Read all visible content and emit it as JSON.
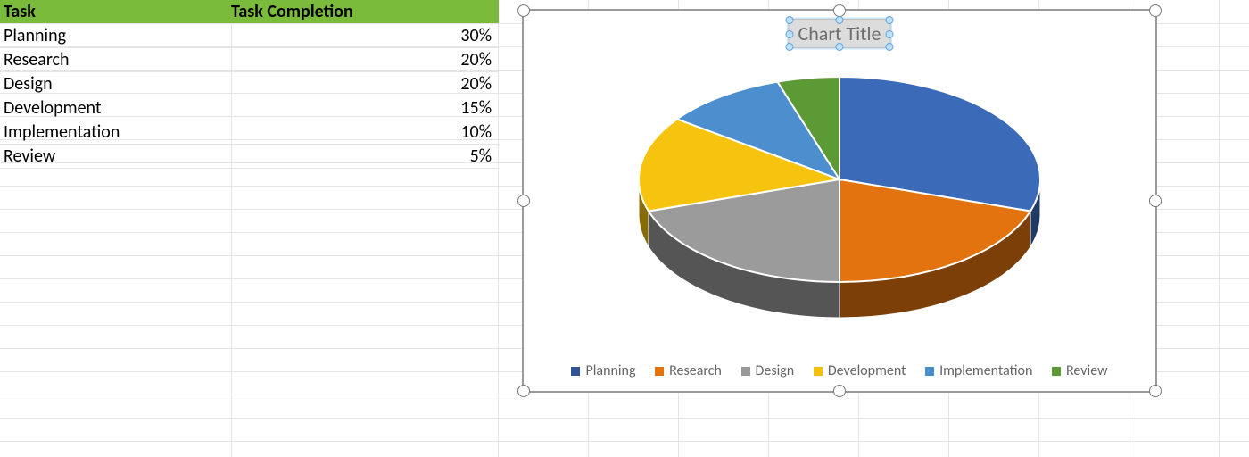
{
  "table": {
    "headers": {
      "task": "Task",
      "completion": "Task Completion"
    },
    "rows": [
      {
        "task": "Planning",
        "pct": "30%"
      },
      {
        "task": "Research",
        "pct": "20%"
      },
      {
        "task": "Design",
        "pct": "20%"
      },
      {
        "task": "Development",
        "pct": "15%"
      },
      {
        "task": "Implementation",
        "pct": "10%"
      },
      {
        "task": "Review",
        "pct": "5%"
      }
    ]
  },
  "chart_title": "Chart Title",
  "legend": {
    "items": [
      {
        "label": "Planning",
        "color": "#2f5597"
      },
      {
        "label": "Research",
        "color": "#e2730f"
      },
      {
        "label": "Design",
        "color": "#999999"
      },
      {
        "label": "Development",
        "color": "#f4bf0a"
      },
      {
        "label": "Implementation",
        "color": "#4d8ecf"
      },
      {
        "label": "Review",
        "color": "#5c9a36"
      }
    ]
  },
  "chart_data": {
    "type": "pie",
    "title": "Chart Title",
    "categories": [
      "Planning",
      "Research",
      "Design",
      "Development",
      "Implementation",
      "Review"
    ],
    "values": [
      30,
      20,
      20,
      15,
      10,
      5
    ],
    "series": [
      {
        "name": "Planning",
        "value": 30,
        "color": "#3a6ab8"
      },
      {
        "name": "Research",
        "value": 20,
        "color": "#e2730f"
      },
      {
        "name": "Design",
        "value": 20,
        "color": "#9b9b9b"
      },
      {
        "name": "Development",
        "value": 15,
        "color": "#f6c40f"
      },
      {
        "name": "Implementation",
        "value": 10,
        "color": "#4d8ecf"
      },
      {
        "name": "Review",
        "value": 5,
        "color": "#5c9a36"
      }
    ],
    "legend_position": "bottom",
    "three_d": true
  }
}
